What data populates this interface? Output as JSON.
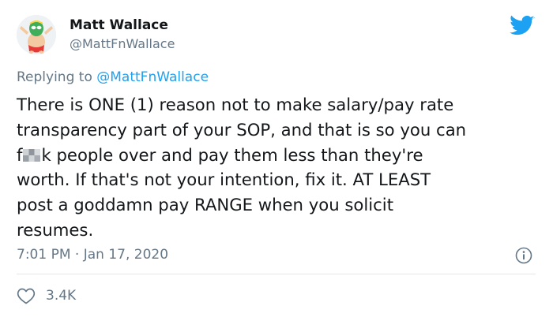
{
  "user": {
    "display_name": "Matt Wallace",
    "handle": "@MattFnWallace"
  },
  "reply": {
    "prefix": "Replying to ",
    "mention": "@MattFnWallace"
  },
  "tweet": {
    "lines": [
      "There is ONE (1) reason not to make salary/pay rate",
      "transparency part of your SOP, and that is so you can",
      "k people over and pay them less than they're",
      "worth. If that's not your intention, fix it. AT LEAST",
      "post a goddamn pay RANGE when you solicit",
      "resumes."
    ],
    "censored_prefix": "f"
  },
  "timestamp": "7:01 PM · Jan 17, 2020",
  "likes": {
    "count": "3.4K"
  },
  "icons": {
    "brand": "twitter-bird-icon",
    "info": "info-icon",
    "like": "heart-icon"
  },
  "colors": {
    "brand_blue": "#1da1f2",
    "text": "#14171a",
    "secondary_text": "#657786",
    "divider": "#e1e8ed"
  }
}
